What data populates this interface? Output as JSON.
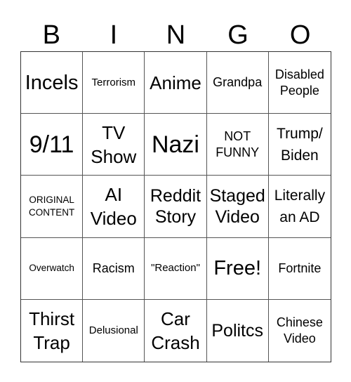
{
  "header": {
    "letters": [
      "B",
      "I",
      "N",
      "G",
      "O"
    ]
  },
  "cells": [
    {
      "text": "Incels",
      "size": "s28"
    },
    {
      "text": "Terrorism",
      "size": "s15"
    },
    {
      "text": "Anime",
      "size": "s24"
    },
    {
      "text": "Grandpa",
      "size": "s17"
    },
    {
      "text": "Disabled\nPeople",
      "size": "s17"
    },
    {
      "text": "9/11",
      "size": "s32"
    },
    {
      "text": "TV\nShow",
      "size": "s24"
    },
    {
      "text": "Nazi",
      "size": "s32"
    },
    {
      "text": "NOT\nFUNNY",
      "size": "s17"
    },
    {
      "text": "Trump/\nBiden",
      "size": "s20"
    },
    {
      "text": "ORIGINAL\nCONTENT",
      "size": "s13"
    },
    {
      "text": "AI\nVideo",
      "size": "s24"
    },
    {
      "text": "Reddit\nStory",
      "size": "s22"
    },
    {
      "text": "Staged\nVideo",
      "size": "s22"
    },
    {
      "text": "Literally\nan AD",
      "size": "s20"
    },
    {
      "text": "Overwatch",
      "size": "s13"
    },
    {
      "text": "Racism",
      "size": "s17"
    },
    {
      "text": "\"Reaction\"",
      "size": "s15"
    },
    {
      "text": "Free!",
      "size": "s28"
    },
    {
      "text": "Fortnite",
      "size": "s17"
    },
    {
      "text": "Thirst\nTrap",
      "size": "s24"
    },
    {
      "text": "Delusional",
      "size": "s15"
    },
    {
      "text": "Car\nCrash",
      "size": "s24"
    },
    {
      "text": "Politcs",
      "size": "s22"
    },
    {
      "text": "Chinese\nVideo",
      "size": "s17"
    }
  ]
}
